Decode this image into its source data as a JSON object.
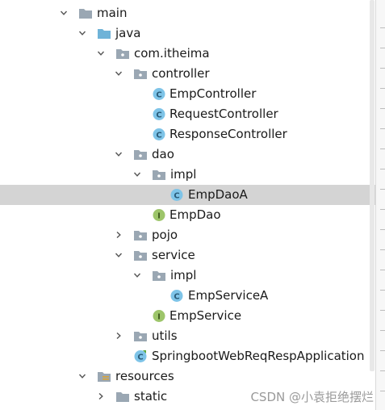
{
  "project_tree": {
    "nodes": [
      {
        "label": "main",
        "icon": "folder-icon",
        "expanded": true
      },
      {
        "label": "java",
        "icon": "source-folder-icon",
        "expanded": true
      },
      {
        "label": "com.itheima",
        "icon": "package-icon",
        "expanded": true
      },
      {
        "label": "controller",
        "icon": "package-icon",
        "expanded": true
      },
      {
        "label": "EmpController",
        "icon": "class-icon"
      },
      {
        "label": "RequestController",
        "icon": "class-icon"
      },
      {
        "label": "ResponseController",
        "icon": "class-icon"
      },
      {
        "label": "dao",
        "icon": "package-icon",
        "expanded": true
      },
      {
        "label": "impl",
        "icon": "package-icon",
        "expanded": true
      },
      {
        "label": "EmpDaoA",
        "icon": "class-icon",
        "selected": true
      },
      {
        "label": "EmpDao",
        "icon": "interface-icon"
      },
      {
        "label": "pojo",
        "icon": "package-icon",
        "expanded": false
      },
      {
        "label": "service",
        "icon": "package-icon",
        "expanded": true
      },
      {
        "label": "impl",
        "icon": "package-icon",
        "expanded": true
      },
      {
        "label": "EmpServiceA",
        "icon": "class-icon"
      },
      {
        "label": "EmpService",
        "icon": "interface-icon"
      },
      {
        "label": "utils",
        "icon": "package-icon",
        "expanded": false
      },
      {
        "label": "SpringbootWebReqRespApplication",
        "icon": "spring-boot-class-icon"
      },
      {
        "label": "resources",
        "icon": "resources-folder-icon",
        "expanded": true
      },
      {
        "label": "static",
        "icon": "folder-icon",
        "expanded": false
      }
    ]
  },
  "watermark": "CSDN @小袁拒绝摆烂",
  "colors": {
    "selection": "#d4d4d4",
    "class_badge": "#7ec4e8",
    "interface_badge": "#9dc56a",
    "folder": "#9aa7b3",
    "source_folder": "#6fb3d8"
  }
}
